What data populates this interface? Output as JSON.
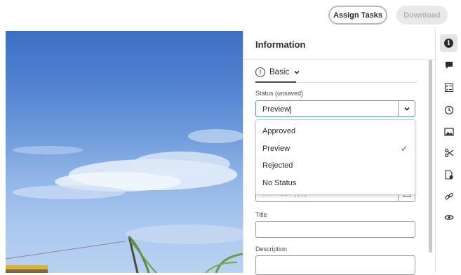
{
  "toolbar": {
    "assign_label": "Assign Tasks",
    "download_label": "Download"
  },
  "panel": {
    "title": "Information",
    "tab_label": "Basic",
    "status_label": "Status (unsaved)",
    "status_value": "Preview",
    "status_options": [
      {
        "label": "Approved",
        "selected": false
      },
      {
        "label": "Preview",
        "selected": true
      },
      {
        "label": "Rejected",
        "selected": false
      },
      {
        "label": "No Status",
        "selected": false
      }
    ],
    "date_placeholder": "mm / dd / yyyy",
    "title_label": "Title",
    "title_value": "",
    "description_label": "Description",
    "description_value": ""
  },
  "rail": {
    "icons": [
      "info-icon",
      "comment-icon",
      "checklist-icon",
      "clock-icon",
      "image-icon",
      "scissors-icon",
      "file-settings-icon",
      "link-icon",
      "eye-icon"
    ],
    "active": "info-icon"
  },
  "colors": {
    "accent": "#2d6ec9",
    "focus_border": "#5a8fd6"
  }
}
